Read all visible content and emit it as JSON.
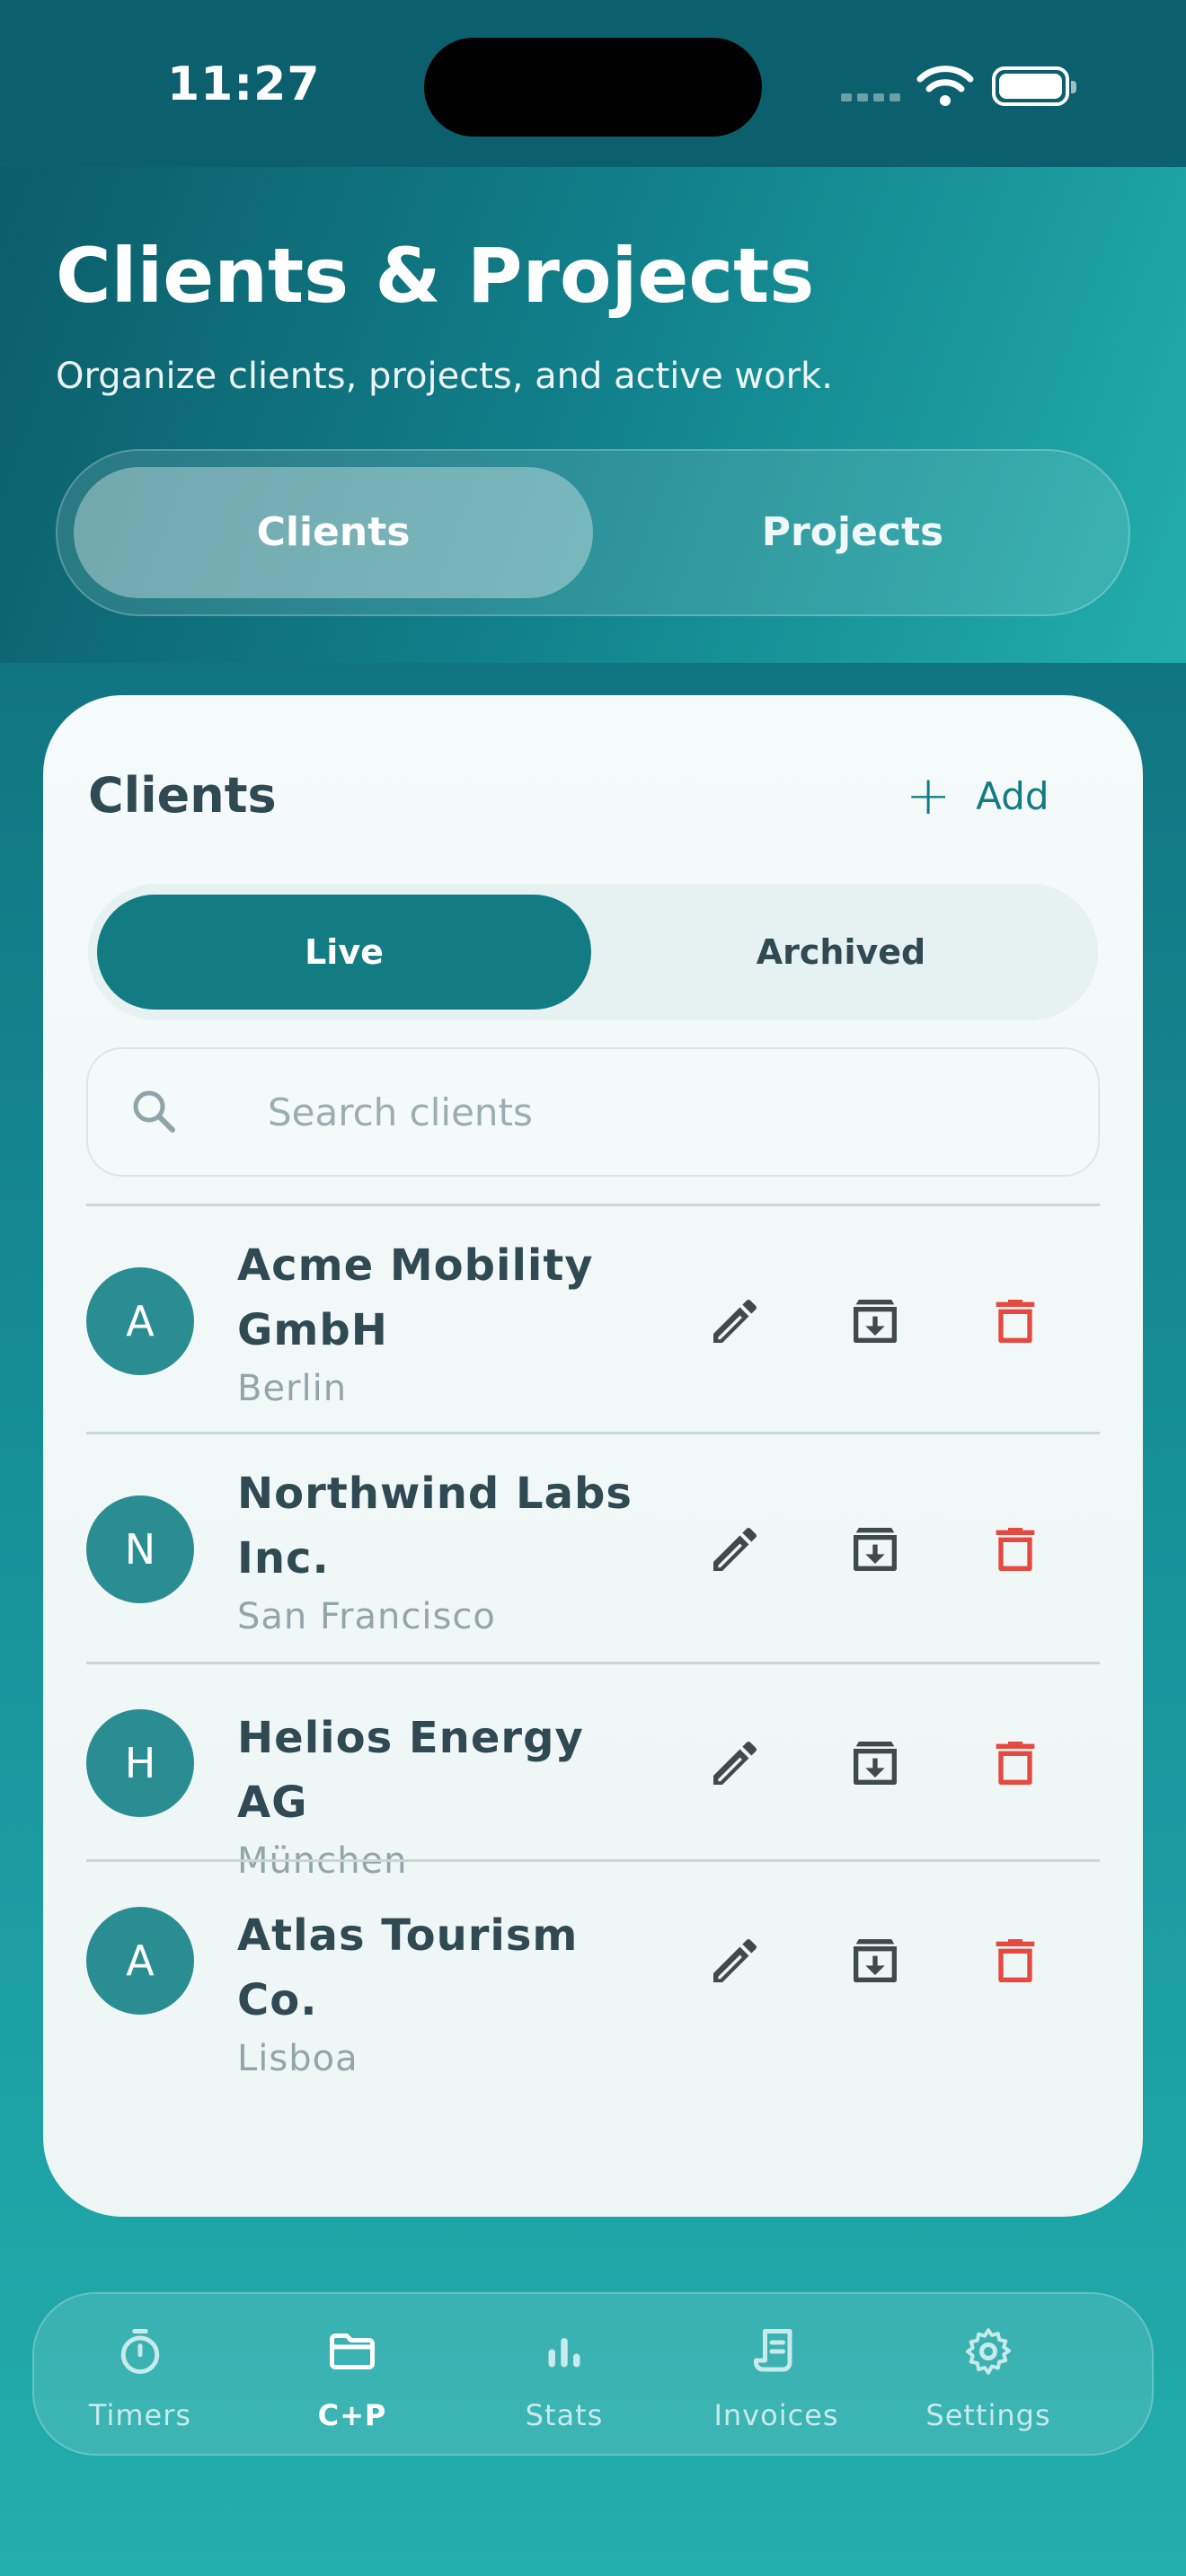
{
  "status_bar": {
    "time": "11:27"
  },
  "header": {
    "title": "Clients & Projects",
    "subtitle": "Organize clients, projects, and active work.",
    "segments": [
      "Clients",
      "Projects"
    ],
    "active_segment": "Clients"
  },
  "clients_card": {
    "title": "Clients",
    "add_label": "Add",
    "filter": {
      "options": [
        "Live",
        "Archived"
      ],
      "active": "Live"
    },
    "search": {
      "placeholder": "Search clients",
      "value": ""
    },
    "clients": [
      {
        "initial": "A",
        "name_lines": [
          "Acme Mobility",
          "GmbH"
        ],
        "city": "Berlin"
      },
      {
        "initial": "N",
        "name_lines": [
          "Northwind Labs",
          "Inc."
        ],
        "city": "San Francisco"
      },
      {
        "initial": "H",
        "name_lines": [
          "Helios Energy AG"
        ],
        "city": "München"
      },
      {
        "initial": "A",
        "name_lines": [
          "Atlas Tourism Co."
        ],
        "city": "Lisboa"
      }
    ],
    "row_actions": [
      {
        "icon": "pencil-icon",
        "color": "#3f4a4d"
      },
      {
        "icon": "archive-icon",
        "color": "#3f4a4d"
      },
      {
        "icon": "trash-icon",
        "color": "#e5493f"
      }
    ]
  },
  "tab_bar": {
    "items": [
      {
        "label": "Timers",
        "icon": "stopwatch-icon"
      },
      {
        "label": "C+P",
        "icon": "folder-icon"
      },
      {
        "label": "Stats",
        "icon": "bar-chart-icon"
      },
      {
        "label": "Invoices",
        "icon": "receipt-icon"
      },
      {
        "label": "Settings",
        "icon": "gear-icon"
      }
    ],
    "active": "C+P"
  },
  "colors": {
    "accent": "#137b82",
    "danger": "#e5493f",
    "avatar": "#2a8d92",
    "text_primary": "#2f4a52",
    "text_secondary": "#91a6aa"
  }
}
